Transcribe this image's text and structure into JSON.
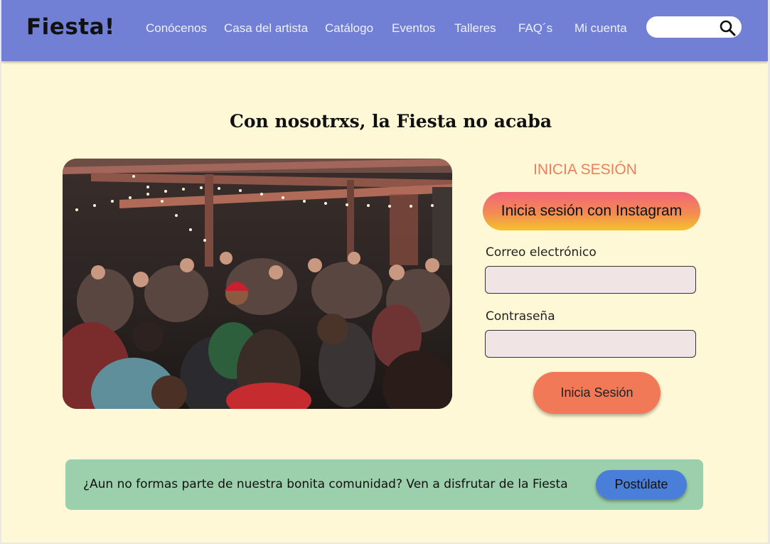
{
  "header": {
    "logo": "Fiesta!",
    "nav": [
      "Conócenos",
      "Casa del artista",
      "Catálogo",
      "Eventos",
      "Talleres",
      "FAQ´s",
      "Mi cuenta"
    ],
    "search": {
      "value": "",
      "placeholder": "",
      "icon": "search-icon"
    }
  },
  "main": {
    "headline": "Con nosotrxs, la Fiesta no acaba",
    "photo": {
      "icon": "party-crowd-photo"
    },
    "login": {
      "title": "INICIA SESIÓN",
      "instagram_button": "Inicia sesión con Instagram",
      "email_label": "Correo electrónico",
      "email_value": "",
      "password_label": "Contraseña",
      "password_value": "",
      "submit_button": "Inicia Sesión"
    }
  },
  "banner": {
    "text": "¿Aun no formas parte de nuestra bonita comunidad? Ven a disfrutar de la Fiesta",
    "button": "Postúlate"
  },
  "colors": {
    "page_bg": "#fef8d6",
    "header_bg": "#717fd4",
    "accent": "#f27957",
    "banner_bg": "#9ccfab",
    "apply_button": "#4a7fd9"
  }
}
